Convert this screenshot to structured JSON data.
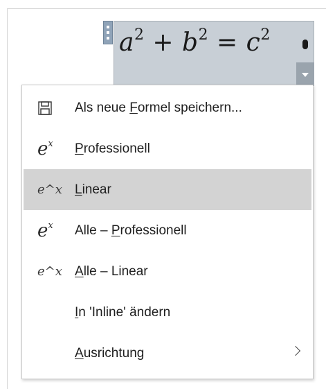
{
  "equation": {
    "base_a": "a",
    "exp_a": "2",
    "plus": " + ",
    "base_b": "b",
    "exp_b": "2",
    "equals": " = ",
    "base_c": "c",
    "exp_c": "2"
  },
  "menu": {
    "items": [
      {
        "icon": "save-icon",
        "pre": "Als neue ",
        "accel": "F",
        "post": "ormel speichern..."
      },
      {
        "icon": "professional-format-icon",
        "icon_base": "e",
        "icon_exp": "x",
        "pre": "",
        "accel": "P",
        "post": "rofessionell"
      },
      {
        "icon": "linear-format-icon",
        "icon_text": "e^x",
        "pre": "",
        "accel": "L",
        "post": "inear"
      },
      {
        "icon": "professional-format-icon",
        "icon_base": "e",
        "icon_exp": "x",
        "pre": "Alle – ",
        "accel": "P",
        "post": "rofessionell"
      },
      {
        "icon": "linear-format-icon",
        "icon_text": "e^x",
        "pre": "",
        "accel": "A",
        "post": "lle – Linear"
      },
      {
        "icon": "",
        "pre": "",
        "accel": "I",
        "post": "n 'Inline' ändern"
      },
      {
        "icon": "chevron-right-icon",
        "pre": "",
        "accel": "A",
        "post": "usrichtung"
      }
    ],
    "highlighted_index": 2
  },
  "colors": {
    "equation_background": "#c8cfd6",
    "highlight": "#d3d3d3"
  }
}
